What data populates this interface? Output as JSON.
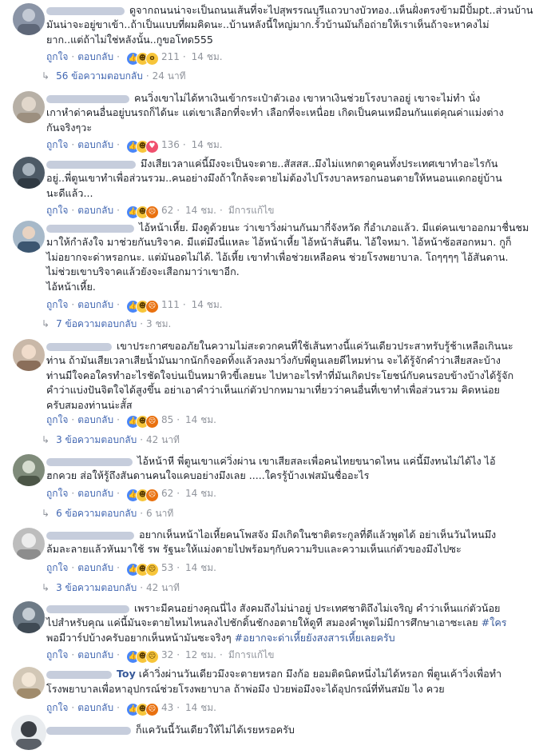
{
  "labels": {
    "like": "ถูกใจ",
    "reply": "ตอบกลับ",
    "edited": "มีการแก้ไข",
    "separator": "·"
  },
  "comments": [
    {
      "lines": [
        "ดูจากถนนน่าจะเป็นถนนเส้นที่จะไปสุพรรณบุรีแถวบางบัวทอง..เห็นฝั่งตรงข้ามมีปั้มpt..ส่วนบ้าน",
        "มันน่าจะอยู่ขาเข้า..ถ้าเป็นแบบที่ผมคิดนะ..บ้านหลังนี้ใหญ่มาก.รั้วบ้านมันก็อถ่ายให้เราเห็นถ้าจะหาคงไม่",
        "ยาก..แต่ถ้าไม่ใช่หลังนั้น..กูขอโทด555"
      ],
      "reactions": [
        "like",
        "haha",
        "wow"
      ],
      "count": "211",
      "time": "14 ชม.",
      "edited": false,
      "replies": {
        "text": "56 ข้อความตอบกลับ",
        "time": "24 นาที"
      }
    },
    {
      "lines": [
        "คนวิ่งเขาไม่ได้หาเงินเข้ากระเป๋าตัวเอง เขาหาเงินช่วยโรงบาลอยู่ เขาจะไม่ทำ นั่ง",
        "เกาหำด่าคนอื่นอยู่บนรถก็ได้นะ แต่เขาเลือกที่จะทำ เลือกที่จะเหนื่อย เกิดเป็นคนเหมือนกันแต่คุณค่าแม่งต่าง",
        "กันจริงๆวะ"
      ],
      "reactions": [
        "like",
        "haha",
        "love"
      ],
      "count": "136",
      "time": "14 ชม.",
      "edited": false,
      "replies": null
    },
    {
      "lines": [
        "มึงเสียเวลาแค่นี้มึงจะเป็นจะตาย..สัสสส..มึงไม่แหกตาดูคนทั้งประเทศเขาทำอะไรกัน",
        "อยู่..พี่ตูนเขาทำเพื่อส่วนรวม..คนอย่างมึงถ้าใกล้จะตายไม่ต้องไปโรงบาลหรอกนอนตายให้หนอนแดกอยู่บ้าน",
        "นะดีแล้ว..."
      ],
      "reactions": [
        "like",
        "haha",
        "angry"
      ],
      "count": "62",
      "time": "14 ชม.",
      "edited": true,
      "replies": null
    },
    {
      "lines": [
        "ไอ้หน้าเหี้ย. มึงดูด้วยนะ ว่าเขาวิ่งผ่านกันมากี่จังหวัด กี่อำเภอแล้ว. มีแต่คนเขาออกมาชื่นชม",
        "มาให้กำลังใจ มาช่วยกันบริจาค. มีแต่มึงนี่แหละ ไอ้หน้าเหี้ย ไอ้หน้าส้นตีน. ไอ้ใจหมา. ไอ้หน้าซ้อสอกหมา. กูก็",
        "ไม่อยากจะด่าหรอกนะ. แต่มันอดไม่ได้. ไอ้เหี้ย เขาทำเพื่อช่วยเหลือคน ช่วยโรงพยาบาล. โถๆๆๆๆ ไอ้สันดาน.",
        "ไม่ช่วยเขาบริจาคแล้วยังจะเสือกมาว่าเขาอีก.",
        "ไอ้หน้าเหี้ย."
      ],
      "reactions": [
        "like",
        "haha",
        "angry"
      ],
      "count": "111",
      "time": "14 ชม.",
      "edited": false,
      "replies": {
        "text": "7 ข้อความตอบกลับ",
        "time": "3 ชม."
      }
    },
    {
      "lines": [
        "เขาประกาศขออภัยในความไม่สะดวกคนที่ใช้เส้นทางนี้แค่วันเดียวประสาทรับรู้ช้าเหลือเกินนะ",
        "ท่าน ถ้ามันเสียเวลาเสียน้ำมันมากนักก็จอดทิ้งแล้วลงมาวิ่งกับพี่ตูนเลยดีไหมท่าน จะได้รู้จักคำว่าเสียสละบ้าง",
        "ท่านมีใจคอใครทำอะไรชัดใจบ่นเป็นหมาหิวขี้เลยนะ ไปหาอะไรทำที่มันเกิดประโยชน์กับคนรอบข้างบ้างได้รู้จัก",
        "คำว่าแบ่งปันจิตใจได้สูงขึ้น อย่าเอาคำว่าเห็นแก่ตัวปากหมามาเที่ยวว่าคนอื่นที่เขาทำเพื่อส่วนรวม คิดหน่อย",
        "ครับสมองท่านน่ะสั้ส"
      ],
      "reactions": [
        "like",
        "haha",
        "angry"
      ],
      "count": "85",
      "time": "14 ชม.",
      "edited": false,
      "replies": {
        "text": "3 ข้อความตอบกลับ",
        "time": "42 นาที"
      }
    },
    {
      "lines": [
        "ไอ้หน้าหี พี่ตูนเขาแค่วิ่งผ่าน เขาเสียสละเพื่อคนไทยขนาดไหน แค่นี้มึงทนไม่ได้ไง ไอ้",
        "ฮกควย ส่อให้รู้ถึงสันดานคนใจแคบอย่างมึงเลย .....ใครรู้บ้างเฟสมันชื่ออะไร"
      ],
      "reactions": [
        "like",
        "haha",
        "angry"
      ],
      "count": "62",
      "time": "14 ชม.",
      "edited": false,
      "replies": {
        "text": "6 ข้อความตอบกลับ",
        "time": "6 นาที"
      }
    },
    {
      "lines": [
        "อยากเห็นหน้าไอเหี้ยคนโพสจัง มึงเกิดในชาติตระกูลที่ดีแล้วพูดได้ อย่าเห็นวันไหนมึง",
        "ล้มละลายแล้วหันมาใช้ รพ รัฐนะให้แม่งตายไปพร้อมๆกับความริบและความเห็นแก่ตัวของมึงไปซะ"
      ],
      "reactions": [
        "like",
        "haha",
        "sad"
      ],
      "count": "53",
      "time": "14 ชม.",
      "edited": false,
      "replies": {
        "text": "3 ข้อความตอบกลับ",
        "time": "42 นาที"
      }
    },
    {
      "lines": [
        "เพราะมีคนอย่างคุณนี่ไง สังคมถึงไม่น่าอยู่ ประเทศชาติถึงไม่เจริญ คำว่าเห็นแก่ตัวน้อย",
        "ไปสำหรับคุณ แค่นี้มันจะตายไหมไหนลงไปชักดิ้นชักงอตายให้ดูที สมองคำพูดไม่มีการศึกษาเอาซะเลย",
        "พอมีวาร์ปบ้างครับอยากเห็นหน้ามันซะจริงๆ"
      ],
      "hashtags": [
        "#ใคร",
        "#อยากจะด่าเหี้ยยังสงสารเหี้ยเลยครับ"
      ],
      "reactions": [
        "like",
        "haha",
        "sad"
      ],
      "count": "32",
      "time": "12 ชม.",
      "edited": true,
      "replies": null
    },
    {
      "author": "Toy",
      "lines": [
        "เค้าวิ่งผ่านวันเดียวมึงจะตายหรอก มึงก้อ ยอมติดนิดหนึ่งไม่ได้หรอก พี่ตูนเค้าวิ่งเพื่อทำ",
        "โรงพยาบาลเพื่อหาอุปกรณ์ช่วยโรงพยาบาล ถ้าพ่อมึง ป่วยพ่อมึงจะได้อุปกรณ์ที่ทันสมัย ไง ควย"
      ],
      "reactions": [
        "like",
        "haha",
        "angry"
      ],
      "count": "43",
      "time": "14 ชม.",
      "edited": false,
      "replies": null
    },
    {
      "lines": [
        "ก็แควันนี้วันเดียวให้ไม่ได้เรยหรอครับ"
      ],
      "reactions": [],
      "count": "",
      "time": "",
      "edited": false,
      "replies": null
    }
  ]
}
